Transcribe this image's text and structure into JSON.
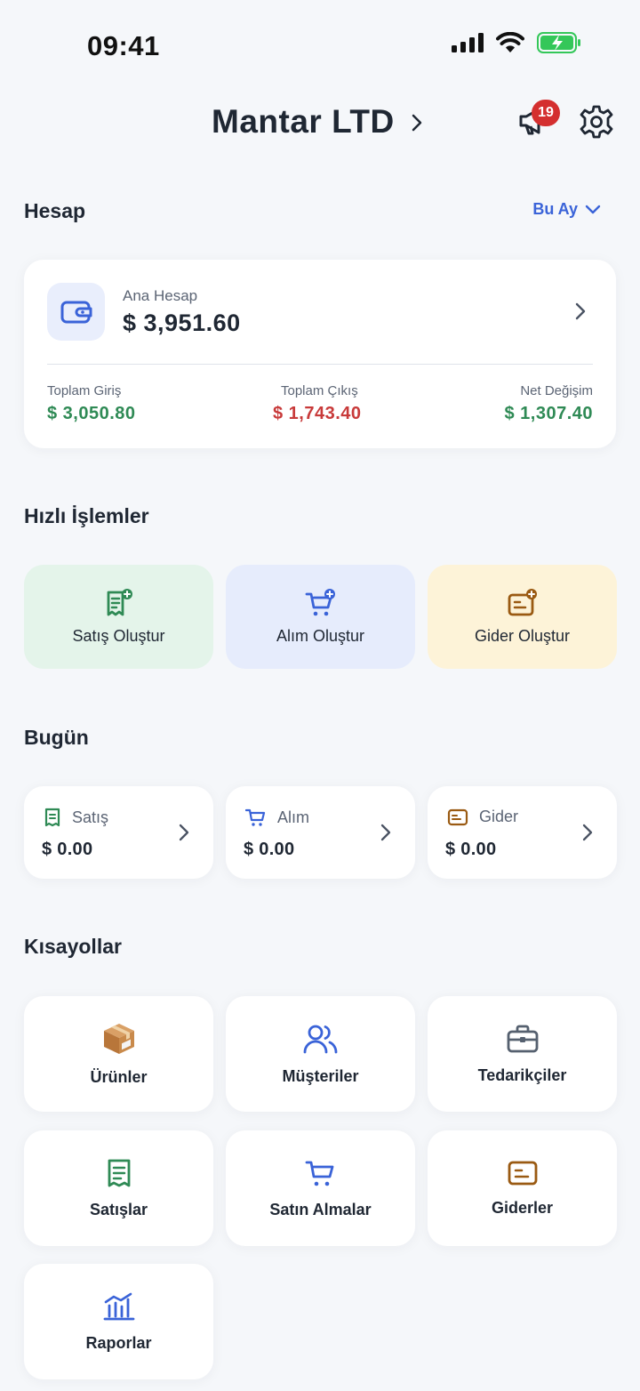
{
  "status_bar": {
    "time": "09:41"
  },
  "header": {
    "company": "Mantar LTD",
    "notification_count": "19"
  },
  "account_section": {
    "title": "Hesap",
    "period": "Bu Ay",
    "account_name": "Ana Hesap",
    "balance": "$ 3,951.60",
    "stats": [
      {
        "label": "Toplam Giriş",
        "value": "$ 3,050.80",
        "tone": "#2f8a55"
      },
      {
        "label": "Toplam Çıkış",
        "value": "$ 1,743.40",
        "tone": "#c83a3a"
      },
      {
        "label": "Net Değişim",
        "value": "$ 1,307.40",
        "tone": "#2f8a55"
      }
    ]
  },
  "quick_actions": {
    "title": "Hızlı İşlemler",
    "items": [
      {
        "label": "Satış Oluştur",
        "icon": "receipt-plus-icon",
        "color": "#2f8a55"
      },
      {
        "label": "Alım Oluştur",
        "icon": "cart-plus-icon",
        "color": "#3a63d8"
      },
      {
        "label": "Gider Oluştur",
        "icon": "expense-plus-icon",
        "color": "#9a5a12"
      }
    ]
  },
  "today": {
    "title": "Bugün",
    "items": [
      {
        "label": "Satış",
        "value": "$ 0.00",
        "icon": "receipt-icon"
      },
      {
        "label": "Alım",
        "value": "$ 0.00",
        "icon": "cart-icon"
      },
      {
        "label": "Gider",
        "value": "$ 0.00",
        "icon": "expense-icon"
      }
    ]
  },
  "shortcuts": {
    "title": "Kısayollar",
    "items": [
      {
        "label": "Ürünler",
        "icon": "package-icon"
      },
      {
        "label": "Müşteriler",
        "icon": "users-icon"
      },
      {
        "label": "Tedarikçiler",
        "icon": "briefcase-icon"
      },
      {
        "label": "Satışlar",
        "icon": "receipt-icon"
      },
      {
        "label": "Satın Almalar",
        "icon": "cart-icon"
      },
      {
        "label": "Giderler",
        "icon": "expense-icon"
      },
      {
        "label": "Raporlar",
        "icon": "chart-icon"
      }
    ]
  }
}
